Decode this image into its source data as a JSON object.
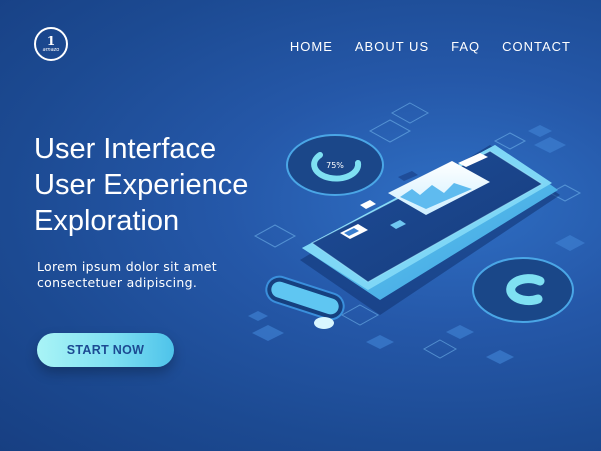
{
  "logo": {
    "number": "1",
    "text": "amazo"
  },
  "nav": {
    "home": "HOME",
    "about": "ABOUT US",
    "faq": "FAQ",
    "contact": "CONTACT"
  },
  "hero": {
    "title_line1": "User Interface",
    "title_line2": "User Experience",
    "title_line3": "Exploration",
    "subtitle_line1": "Lorem ipsum dolor sit amet",
    "subtitle_line2": "consectetuer adipiscing.",
    "cta_label": "START NOW"
  },
  "illustration": {
    "gauge_label": "75%"
  },
  "colors": {
    "background": "#2558a9",
    "accent": "#7fe0f2",
    "cta_text": "#1c4a92"
  }
}
